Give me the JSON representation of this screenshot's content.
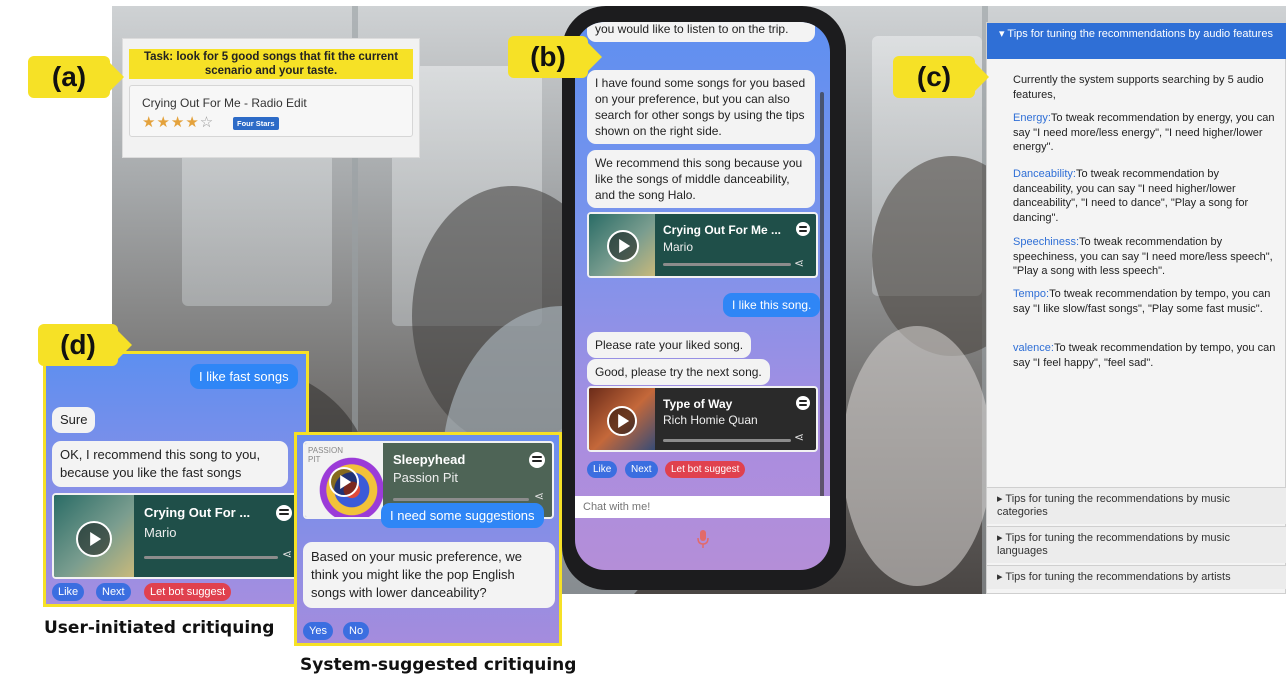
{
  "tags": {
    "a": "(a)",
    "b": "(b)",
    "c": "(c)",
    "d": "(d)"
  },
  "panel_a": {
    "task": "Task: look for 5 good songs that fit the current scenario and your taste.",
    "song_title": "Crying Out For Me - Radio Edit",
    "stars": "★★★★",
    "stars_off": "☆",
    "rating_badge": "Four Stars"
  },
  "phone": {
    "msg_top": "you would like to listen to on the trip.",
    "msg_found": "I have found some songs for you based on your preference, but you can also search for other songs by using the tips shown on the right side.",
    "msg_recommend": "We recommend this song because you like the songs of middle danceability, and the song Halo.",
    "card1": {
      "title": "Crying Out For Me ...",
      "artist": "Mario"
    },
    "user_like": "I like this song.",
    "msg_rate": "Please rate your liked song.",
    "msg_next": "Good, please try the next song.",
    "card2": {
      "title": "Type of Way",
      "artist": "Rich Homie Quan"
    },
    "btn_like": "Like",
    "btn_next": "Next",
    "btn_suggest": "Let bot suggest",
    "input_placeholder": "Chat with me!"
  },
  "panel_c": {
    "header": "▾ Tips for tuning the recommendations by audio features",
    "intro": "Currently the system supports searching by 5 audio features,",
    "energy_kw": "Energy:",
    "energy_text": "To tweak recommendation by energy, you can say \"I need more/less energy\", \"I need higher/lower energy\".",
    "dance_kw": "Danceability:",
    "dance_text": "To tweak recommendation by danceability, you can say \"I need higher/lower danceability\", \"I need to dance\", \"Play a song for dancing\".",
    "speech_kw": "Speechiness:",
    "speech_text": "To tweak recommendation by speechiness, you can say \"I need more/less speech\", \"Play a song with less speech\".",
    "tempo_kw": "Tempo:",
    "tempo_text": "To tweak recommendation by tempo, you can say \"I like slow/fast songs\", \"Play some fast music\".",
    "valence_kw": "valence:",
    "valence_text": "To tweak recommendation by tempo, you can say \"I feel happy\", \"feel sad\".",
    "acc_categories": "▸ Tips for tuning the recommendations by music categories",
    "acc_languages": "▸ Tips for tuning the recommendations by music languages",
    "acc_artists": "▸ Tips for tuning the recommendations by artists"
  },
  "panel_d1": {
    "user_msg": "I like fast songs",
    "bot_sure": "Sure",
    "bot_recommend": "OK, I recommend this song to you, because you like the fast songs",
    "card": {
      "title": "Crying Out For ...",
      "artist": "Mario"
    },
    "btn_like": "Like",
    "btn_next": "Next",
    "btn_suggest": "Let bot suggest"
  },
  "panel_d2": {
    "album_text": "PASSION PIT",
    "card": {
      "title": "Sleepyhead",
      "artist": "Passion Pit"
    },
    "user_msg": "I need some suggestions",
    "bot_msg": "Based on your music preference, we think you might like the pop English songs with lower danceability?",
    "btn_yes": "Yes",
    "btn_no": "No"
  },
  "captions": {
    "user_initiated": "User-initiated critiquing",
    "system_suggested": "System-suggested critiquing"
  },
  "colors": {
    "tag": "#f6e126",
    "user_bubble": "#2f86f6",
    "accent_blue": "#2f6fd6",
    "suggest_red": "#e0414e"
  }
}
